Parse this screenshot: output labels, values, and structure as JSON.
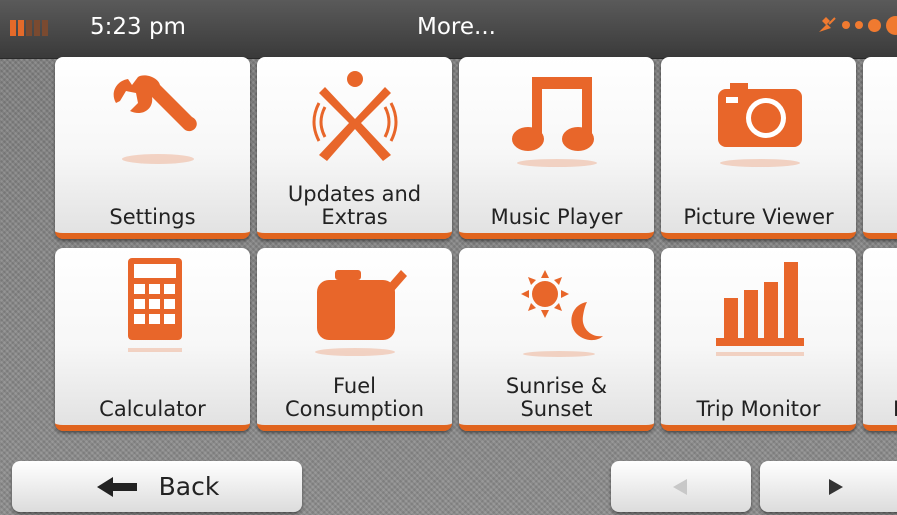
{
  "statusbar": {
    "time": "5:23 pm",
    "title": "More..."
  },
  "tiles": [
    {
      "label": "Settings",
      "icon": "wrench-icon"
    },
    {
      "label": "Updates and\nExtras",
      "icon": "updates-icon"
    },
    {
      "label": "Music Player",
      "icon": "music-note-icon"
    },
    {
      "label": "Picture Viewer",
      "icon": "camera-icon"
    },
    {
      "label": "Calculator",
      "icon": "calculator-icon"
    },
    {
      "label": "Fuel\nConsumption",
      "icon": "fuel-can-icon"
    },
    {
      "label": "Sunrise &\nSunset",
      "icon": "sun-moon-icon"
    },
    {
      "label": "Trip Monitor",
      "icon": "bar-chart-icon"
    }
  ],
  "partial_tile_label": "I",
  "bottombar": {
    "back_label": "Back"
  },
  "colors": {
    "accent": "#e8662a",
    "accent_dark": "#d4541b",
    "status_bar": "#454545",
    "background": "#888888",
    "tile": "#f5f5f5"
  }
}
